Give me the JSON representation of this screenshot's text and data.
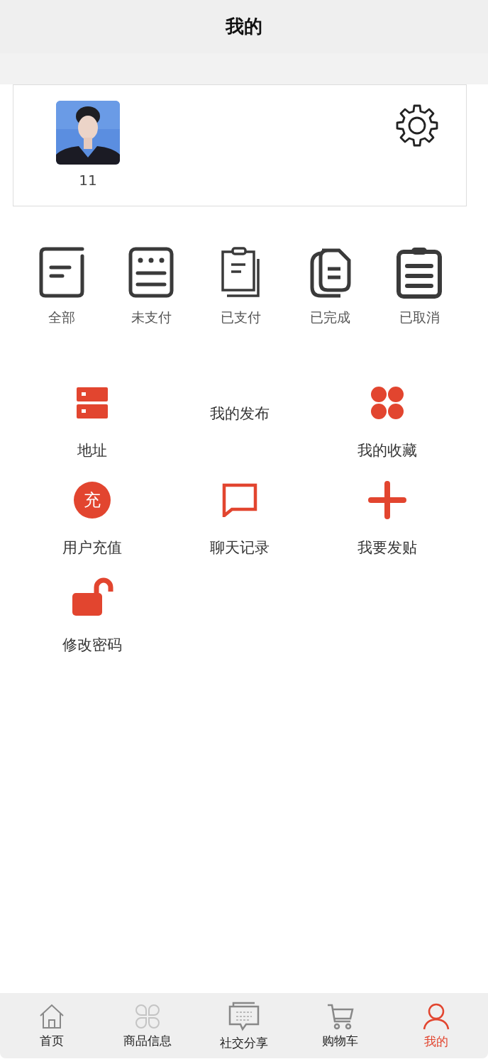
{
  "header": {
    "title": "我的"
  },
  "profile": {
    "name": "11"
  },
  "orders": [
    {
      "label": "全部"
    },
    {
      "label": "未支付"
    },
    {
      "label": "已支付"
    },
    {
      "label": "已完成"
    },
    {
      "label": "已取消"
    }
  ],
  "menu": [
    {
      "label": "地址",
      "kind": "icon"
    },
    {
      "label": "我的发布",
      "kind": "text"
    },
    {
      "label": "我的收藏",
      "kind": "icon"
    },
    {
      "label": "用户充值",
      "kind": "icon",
      "icon_text": "充"
    },
    {
      "label": "聊天记录",
      "kind": "icon"
    },
    {
      "label": "我要发贴",
      "kind": "icon"
    },
    {
      "label": "修改密码",
      "kind": "icon"
    }
  ],
  "tabbar": [
    {
      "label": "首页",
      "selected": false
    },
    {
      "label": "商品信息",
      "selected": false
    },
    {
      "label": "社交分享",
      "selected": false
    },
    {
      "label": "购物车",
      "selected": false
    },
    {
      "label": "我的",
      "selected": true
    }
  ]
}
